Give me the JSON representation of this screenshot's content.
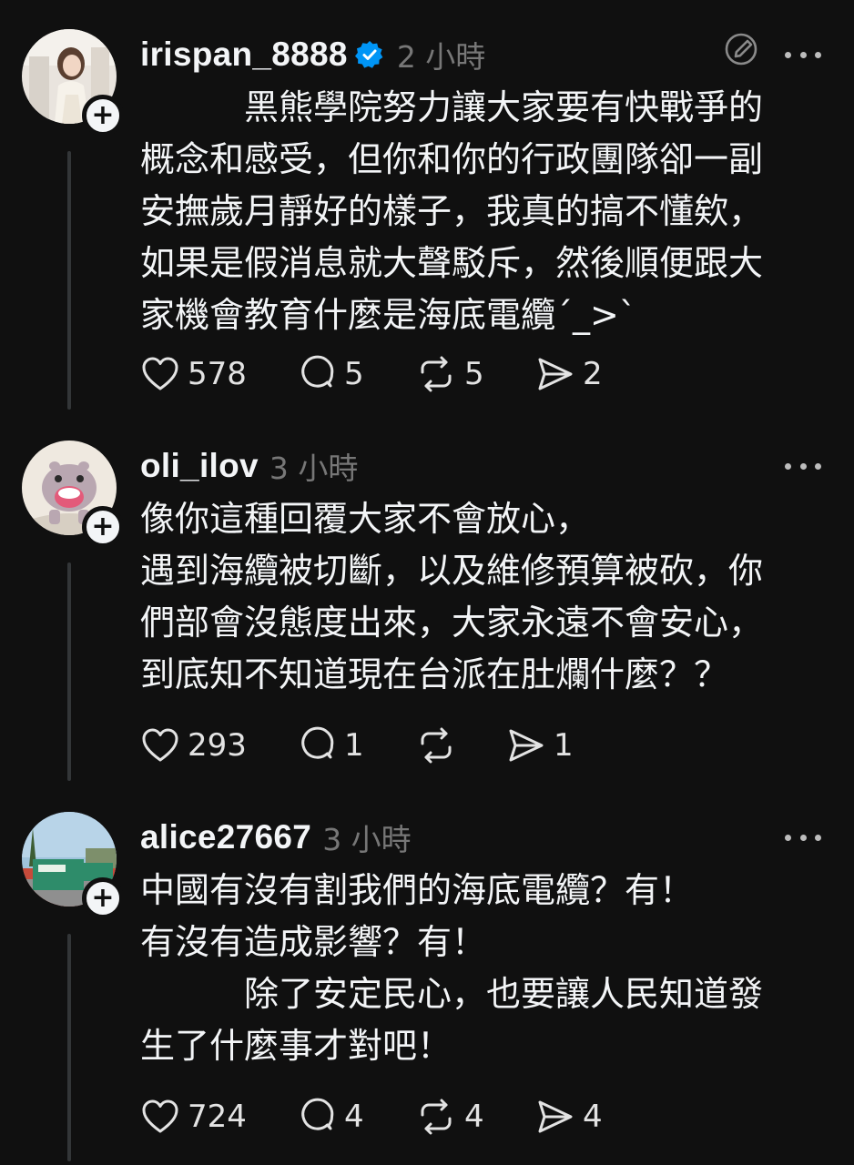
{
  "posts": [
    {
      "username": "irispan_8888",
      "verified": true,
      "timestamp": "2 小時",
      "text": "　　　黑熊學院努力讓大家要有快戰爭的\n概念和感受，但你和你的行政團隊卻一副\n安撫歲月靜好的樣子，我真的搞不懂欸，\n如果是假消息就大聲駁斥，然後順便跟大\n家機會教育什麼是海底電纜ˊ_>ˋ",
      "likes": "578",
      "replies": "5",
      "reposts": "5",
      "shares": "2"
    },
    {
      "username": "oli_ilov",
      "verified": false,
      "timestamp": "3 小時",
      "text": "像你這種回覆大家不會放心，\n遇到海纜被切斷，以及維修預算被砍，你\n們部會沒態度出來，大家永遠不會安心，\n到底知不知道現在台派在肚爛什麼？？",
      "likes": "293",
      "replies": "1",
      "reposts": "",
      "shares": "1"
    },
    {
      "username": "alice27667",
      "verified": false,
      "timestamp": "3 小時",
      "text": "中國有沒有割我們的海底電纜？有！\n有沒有造成影響？有！\n　　　除了安定民心，也要讓人民知道發\n生了什麼事才對吧！",
      "likes": "724",
      "replies": "4",
      "reposts": "4",
      "shares": "4"
    }
  ],
  "icons": {
    "verified_color": "#0095f6",
    "more": "more-icon",
    "like": "heart-icon",
    "reply": "comment-icon",
    "repost": "repost-icon",
    "share": "share-icon"
  }
}
